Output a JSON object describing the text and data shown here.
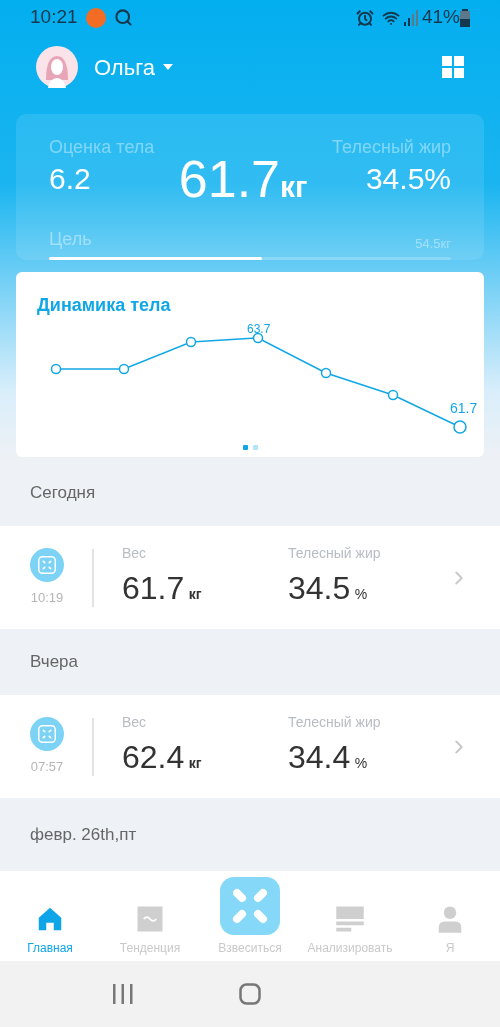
{
  "status_bar": {
    "time": "10:21",
    "battery": "41%"
  },
  "profile": {
    "name": "Ольга"
  },
  "summary": {
    "score_label": "Оценка тела",
    "score": "6.2",
    "weight": "61.7",
    "weight_unit": "кг",
    "fat_label": "Телесный жир",
    "fat": "34.5%",
    "goal_label": "Цель",
    "goal_value": "54.5кг",
    "level": 0.53
  },
  "trend_card": {
    "title": "Динамика тела",
    "peak_label": "63.7",
    "last_label": "61.7",
    "pages": [
      {
        "selected": true
      },
      {
        "selected": false
      }
    ]
  },
  "days": [
    {
      "heading": "Сегодня",
      "time": "10:19",
      "weight_label": "Вес",
      "weight": "61.7",
      "weight_unit": "кг",
      "fat_label": "Телесный жир",
      "fat": "34.5",
      "fat_unit": "%"
    },
    {
      "heading": "Вчера",
      "time": "07:57",
      "weight_label": "Вес",
      "weight": "62.4",
      "weight_unit": "кг",
      "fat_label": "Телесный жир",
      "fat": "34.4",
      "fat_unit": "%"
    }
  ],
  "next_heading": "февр. 26th,пт",
  "tabs": [
    {
      "kind": "home",
      "label": "Главная",
      "selected": true
    },
    {
      "kind": "trend",
      "label": "Тенденция",
      "selected": false
    },
    {
      "kind": "weigh",
      "label": "Взвеситься",
      "selected": false
    },
    {
      "kind": "analyze",
      "label": "Анализировать",
      "selected": false
    },
    {
      "kind": "me",
      "label": "Я",
      "selected": false
    }
  ]
}
